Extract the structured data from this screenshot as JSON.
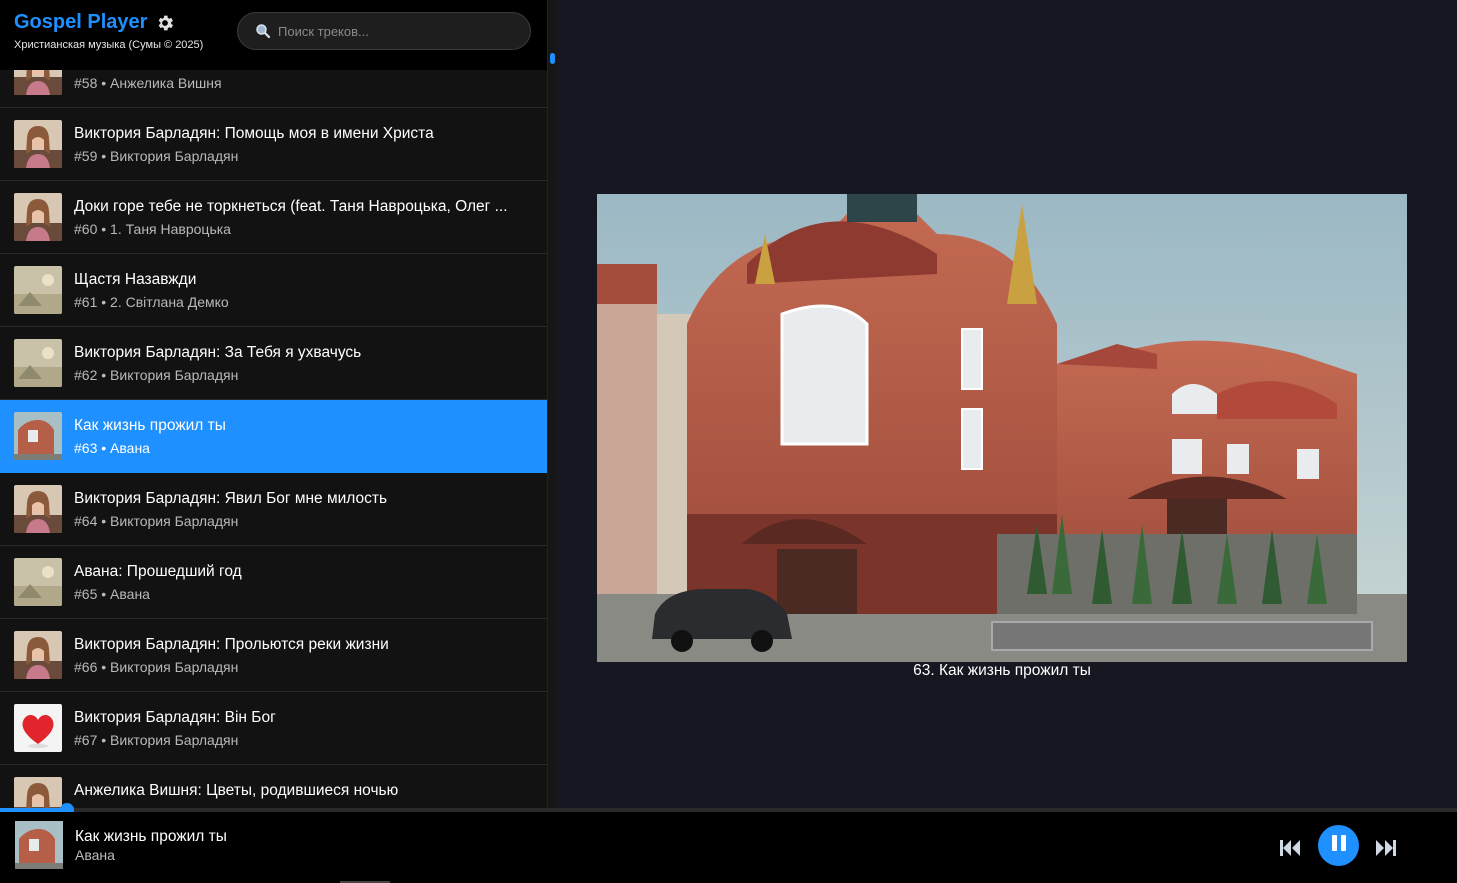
{
  "app": {
    "title": "Gospel Player",
    "subtitle": "Христианская музыка (Сумы © 2025)",
    "accent_color": "#1e90ff"
  },
  "search": {
    "placeholder": "Поиск треков..."
  },
  "tracks": [
    {
      "title": "",
      "meta": "#58 • Анжелика Вишня",
      "thumb_icon": "portrait-cover",
      "active": false
    },
    {
      "title": "Виктория Барладян: Помощь моя в имени Христа",
      "meta": "#59 • Виктория Барладян",
      "thumb_icon": "portrait-cover",
      "active": false
    },
    {
      "title": "Доки горе тебе не торкнеться (feat. Таня Навроцька, Олег ...",
      "meta": "#60 • 1. Таня Навроцька",
      "thumb_icon": "portrait-cover",
      "active": false
    },
    {
      "title": "Щастя Назавжди",
      "meta": "#61 • 2. Світлана Демко",
      "thumb_icon": "album-cover",
      "active": false
    },
    {
      "title": "Виктория Барладян: За Тебя я ухвачусь",
      "meta": "#62 • Виктория Барладян",
      "thumb_icon": "album-cover",
      "active": false
    },
    {
      "title": "Как жизнь прожил ты",
      "meta": "#63 • Авана",
      "thumb_icon": "building-cover",
      "active": true
    },
    {
      "title": "Виктория Барладян: Явил Бог мне милость",
      "meta": "#64 • Виктория Барладян",
      "thumb_icon": "portrait-cover",
      "active": false
    },
    {
      "title": "Авана: Прошедший год",
      "meta": "#65 • Авана",
      "thumb_icon": "album-cover",
      "active": false
    },
    {
      "title": "Виктория Барладян: Прольются реки жизни",
      "meta": "#66 • Виктория Барладян",
      "thumb_icon": "portrait-cover",
      "active": false
    },
    {
      "title": "Виктория Барладян: Він Бог",
      "meta": "#67 • Виктория Барладян",
      "thumb_icon": "heart-cover",
      "active": false
    },
    {
      "title": "Анжелика Вишня: Цветы, родившиеся ночью",
      "meta": "",
      "thumb_icon": "portrait-cover",
      "active": false
    }
  ],
  "now_playing": {
    "caption": "63. Как жизнь прожил ты",
    "title": "Как жизнь прожил ты",
    "artist": "Авана",
    "progress": 0.046
  },
  "icons": {
    "settings": "gear-icon",
    "search": "search-icon",
    "prev": "skip-previous-icon",
    "play_pause": "pause-icon",
    "next": "skip-next-icon"
  }
}
